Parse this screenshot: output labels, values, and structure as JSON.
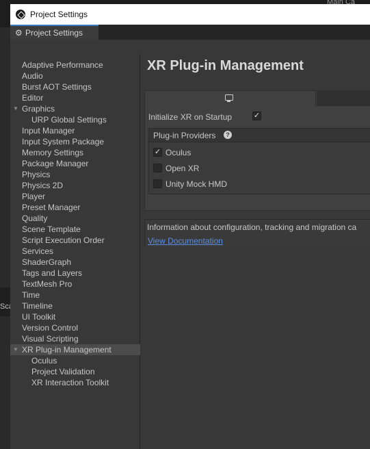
{
  "window": {
    "title": "Project Settings",
    "tab_label": "Project Settings"
  },
  "background": {
    "top_right_fragment": "Main Ca",
    "left_fragment": "Sca"
  },
  "sidebar": {
    "items": [
      {
        "label": "Adaptive Performance",
        "indent": 0
      },
      {
        "label": "Audio",
        "indent": 0
      },
      {
        "label": "Burst AOT Settings",
        "indent": 0
      },
      {
        "label": "Editor",
        "indent": 0
      },
      {
        "label": "Graphics",
        "indent": 0,
        "expanded": true
      },
      {
        "label": "URP Global Settings",
        "indent": 1
      },
      {
        "label": "Input Manager",
        "indent": 0
      },
      {
        "label": "Input System Package",
        "indent": 0
      },
      {
        "label": "Memory Settings",
        "indent": 0
      },
      {
        "label": "Package Manager",
        "indent": 0
      },
      {
        "label": "Physics",
        "indent": 0
      },
      {
        "label": "Physics 2D",
        "indent": 0
      },
      {
        "label": "Player",
        "indent": 0
      },
      {
        "label": "Preset Manager",
        "indent": 0
      },
      {
        "label": "Quality",
        "indent": 0
      },
      {
        "label": "Scene Template",
        "indent": 0
      },
      {
        "label": "Script Execution Order",
        "indent": 0
      },
      {
        "label": "Services",
        "indent": 0
      },
      {
        "label": "ShaderGraph",
        "indent": 0
      },
      {
        "label": "Tags and Layers",
        "indent": 0
      },
      {
        "label": "TextMesh Pro",
        "indent": 0
      },
      {
        "label": "Time",
        "indent": 0
      },
      {
        "label": "Timeline",
        "indent": 0
      },
      {
        "label": "UI Toolkit",
        "indent": 0
      },
      {
        "label": "Version Control",
        "indent": 0
      },
      {
        "label": "Visual Scripting",
        "indent": 0
      },
      {
        "label": "XR Plug-in Management",
        "indent": 0,
        "expanded": true,
        "selected": true
      },
      {
        "label": "Oculus",
        "indent": 1
      },
      {
        "label": "Project Validation",
        "indent": 1
      },
      {
        "label": "XR Interaction Toolkit",
        "indent": 1
      }
    ]
  },
  "main": {
    "title": "XR Plug-in Management",
    "platform_tabs": [
      {
        "icon": "monitor-icon",
        "active": true
      },
      {
        "icon": "",
        "active": false
      }
    ],
    "init_label": "Initialize XR on Startup",
    "init_checked": true,
    "providers_title": "Plug-in Providers",
    "providers": [
      {
        "label": "Oculus",
        "checked": true
      },
      {
        "label": "Open XR",
        "checked": false
      },
      {
        "label": "Unity Mock HMD",
        "checked": false
      }
    ],
    "info_text": "Information about configuration, tracking and migration ca",
    "doc_link": "View Documentation"
  },
  "colors": {
    "selection": "#4c4c4c",
    "tab_accent": "#3a79bb",
    "link": "#5b8ee0"
  }
}
